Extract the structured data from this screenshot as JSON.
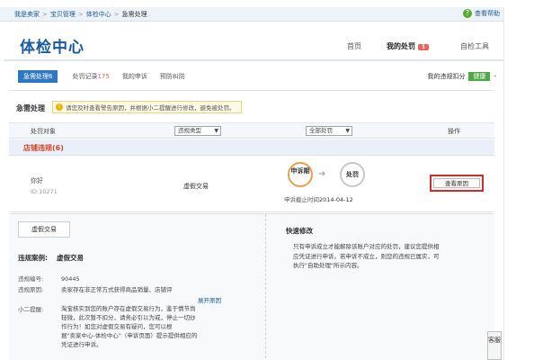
{
  "breadcrumb": [
    "我是卖家",
    "宝贝管理",
    "体检中心",
    "急需处理"
  ],
  "help_label": "查看帮助",
  "header": {
    "title": "体检中心",
    "nav": [
      {
        "label": "首页"
      },
      {
        "label": "我的处罚",
        "badge": "1"
      },
      {
        "label": "自检工具"
      }
    ]
  },
  "tabs": [
    {
      "label": "急需处理6",
      "active": true
    },
    {
      "label": "处罚记录",
      "count": "175"
    },
    {
      "label": "我的申诉"
    },
    {
      "label": "预防纠防"
    }
  ],
  "score": {
    "label": "我的违规扣分",
    "value": "健康",
    "caret": "-"
  },
  "urgent": {
    "label": "急需处理",
    "tip": "请您及时查看警告原因，并根据小二提醒进行修改，避免被处罚。"
  },
  "table": {
    "headers": [
      "处罚对象",
      "违规类型",
      "全部处罚",
      "操作"
    ],
    "group_label": "店铺违规(6)",
    "row": {
      "name": "你好",
      "id": "ID:10271",
      "type": "虚假交易",
      "flow_step1": "申诉期",
      "flow_step2": "处罚",
      "deadline_label": "申诉截止时间",
      "deadline": "2014-04-12",
      "action": "查看原因"
    }
  },
  "detail": {
    "pill": "虚假交易",
    "case_label": "违规案例:",
    "case_value": "虚假交易",
    "number_label": "违规编号:",
    "number_value": "90445",
    "reason_label": "违规原因:",
    "reason_text": "卖家存在非正常方式获得商品销量、店铺评",
    "expand": "展开原因",
    "reminder_label": "小二提醒:",
    "reminder_lines": [
      "淘宝核实到您的账户存在虚假交易行为，鉴于情节尚",
      "轻微，此次暂不扣分，请务必引以为戒，停止一切炒",
      "作行为！如您对虚假交易有疑问，您可以根",
      "据\"卖家中心-体检中心\"（申诉页面）提示提供相应的",
      "凭证进行申诉。"
    ],
    "quick_title": "快速修改",
    "quick_lines": [
      "只有申诉成立才能解除该账户对应的处罚，建议您提供相",
      "应凭证进行申诉。若申诉不成立，则您的违规已属实，可",
      "执行\"自助处理\"所示内容。"
    ]
  },
  "side_tab": "客服"
}
